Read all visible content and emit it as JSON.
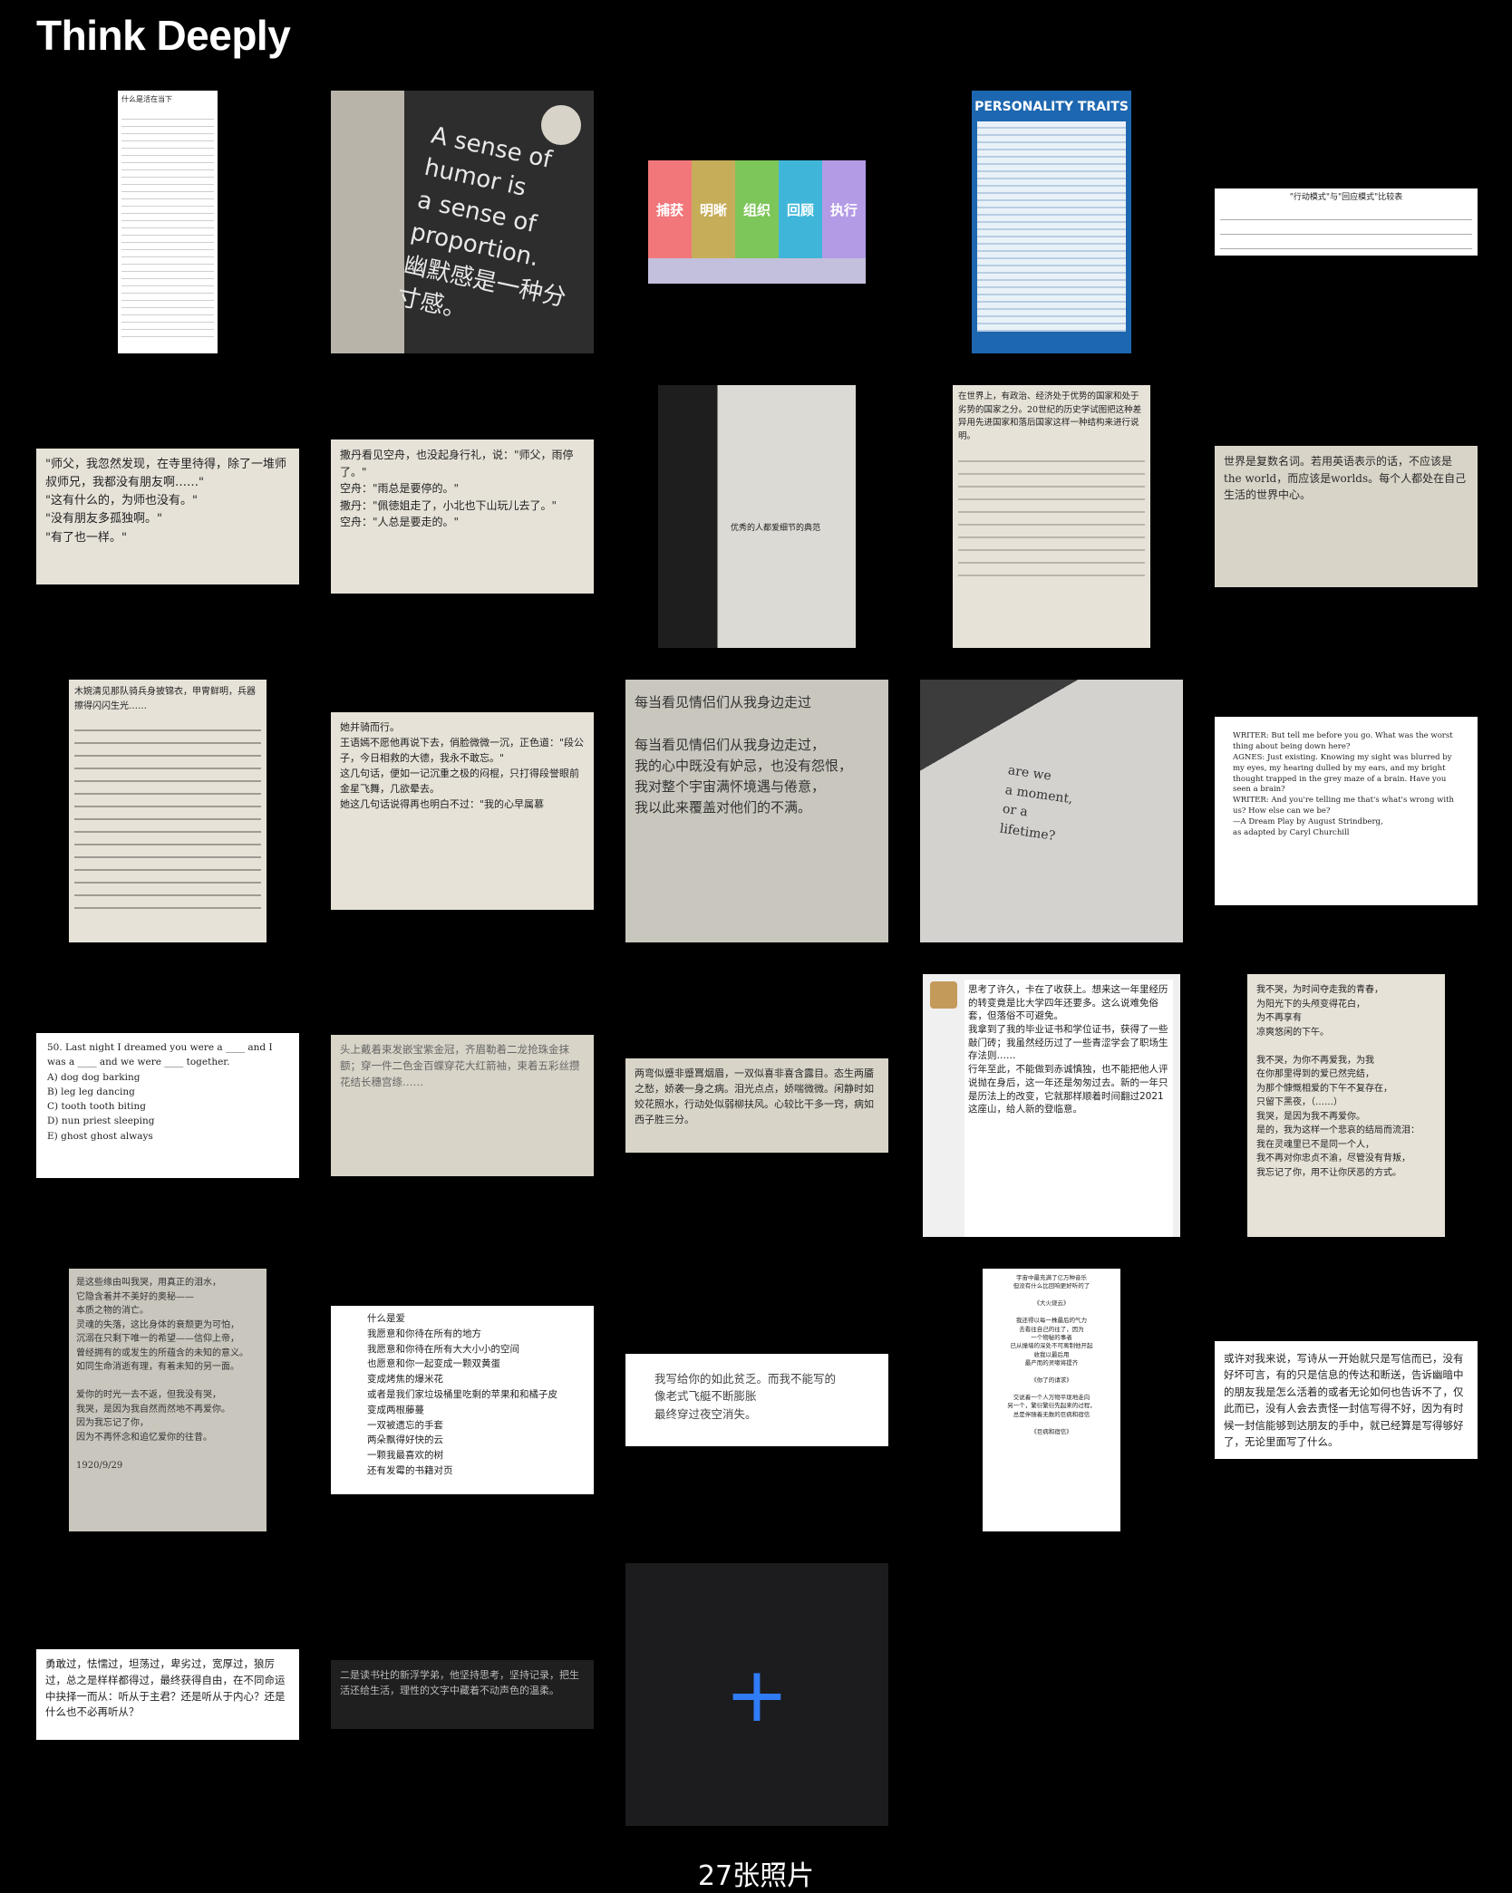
{
  "header": {
    "title": "Think Deeply"
  },
  "footer": {
    "photo_count": "27张照片"
  },
  "add_button": {
    "icon": "plus-icon",
    "label": "+",
    "color": "#2f7cf6"
  },
  "photos": [
    {
      "text": "什么是活在当下",
      "kind": "article"
    },
    {
      "text": "A sense of humor is\na sense of\nproportion.\n幽默感是一种分寸感。",
      "kind": "sign"
    },
    {
      "text": "捕获 明晰 组织 回顾 执行",
      "kind": "color-strip",
      "segments": [
        "捕获",
        "明晰",
        "组织",
        "回顾",
        "执行"
      ],
      "colors": [
        "#f2777a",
        "#c6ad5a",
        "#7dc65a",
        "#3fb6d9",
        "#b39be6"
      ]
    },
    {
      "text": "PERSONALITY TRAITS",
      "kind": "poster"
    },
    {
      "text": "\"行动模式\"与\"回应模式\"比较表",
      "kind": "table"
    },
    {
      "text": "\"师父，我忽然发现，在寺里待得，除了一堆师叔师兄，我都没有朋友啊……\"\n\"这有什么的，为师也没有。\"\n\"没有朋友多孤独啊。\"\n\"有了也一样。\"",
      "kind": "book"
    },
    {
      "text": "撒丹看见空舟，也没起身行礼，说：\"师父，雨停了。\"\n空舟：\"雨总是要停的。\"\n撒丹：\"佩徳姐走了，小北也下山玩儿去了。\"\n空舟：\"人总是要走的。\"",
      "kind": "book"
    },
    {
      "text": "优秀的人都爱细节的典范",
      "kind": "book-photo"
    },
    {
      "text": "在世界上，有政治、经济处于优势的国家和处于劣势的国家之分。20世纪的历史学试图把这种差异用先进国家和落后国家这样一种结构来进行说明。",
      "kind": "book"
    },
    {
      "text": "世界是复数名词。若用英语表示的话，不应该是the world，而应该是worlds。每个人都处在自己生活的世界中心。",
      "kind": "book"
    },
    {
      "text": "木婉清见那队骑兵身披锦衣，甲冑鲜明，兵器擦得闪闪生光……",
      "kind": "book"
    },
    {
      "text": "她并骑而行。\n王语嫣不愿他再说下去，俏脸微微一沉，正色道：\"段公子，今日相救的大德，我永不敢忘。\"\n这几句话，便如一记沉重之极的闷棍，只打得段誉眼前金星飞舞，几欲晕去。\n她这几句话说得再也明白不过：\"我的心早属慕",
      "kind": "book"
    },
    {
      "text": "每当看见情侣们从我身边走过\n\n每当看见情侣们从我身边走过，\n我的心中既没有妒忌，也没有怨恨，\n我对整个宇宙满怀境遇与倦意，\n我以此来覆盖对他们的不满。",
      "kind": "book"
    },
    {
      "text": "are we\na moment,\nor a\nlifetime?",
      "kind": "book-photo"
    },
    {
      "text": "WRITER: But tell me before you go. What was the worst thing about being down here?\nAGNES: Just existing. Knowing my sight was blurred by my eyes, my hearing dulled by my ears, and my bright thought trapped in the grey maze of a brain. Have you seen a brain?\nWRITER: And you're telling me that's what's wrong with us? How else can we be?\n—A Dream Play by August Strindberg,\nas adapted by Caryl Churchill",
      "kind": "script"
    },
    {
      "text": "50. Last night I dreamed you were a ____ and I was a ____ and we were ____ together.\nA) dog dog barking\nB) leg leg dancing\nC) tooth tooth biting\nD) nun priest sleeping\nE) ghost ghost always",
      "kind": "quiz"
    },
    {
      "text": "头上戴着束发嵌宝紫金冠，齐眉勒着二龙抢珠金抹额；穿一件二色金百蝶穿花大红箭袖，束着五彩丝攒花结长穗宫绦……",
      "kind": "book"
    },
    {
      "text": "两弯似蹙非蹙罥烟眉，一双似喜非喜含露目。态生两靥之愁，娇袭一身之病。泪光点点，娇喘微微。闲静时如姣花照水，行动处似弱柳扶风。心较比干多一窍，病如西子胜三分。",
      "kind": "book"
    },
    {
      "text": "思考了许久，卡在了收获上。想来这一年里经历的转变竟是比大学四年还要多。这么说难免俗套，但落俗不可避免。\n我拿到了我的毕业证书和学位证书，获得了一些敲门砖；我虽然经历过了一些青涩学会了职场生存法则……\n行年至此，不能做到赤诚慎独，也不能把他人评说抛在身后，这一年还是匆匆过去。新的一年只是历法上的改变，它就那样顺着时间翻过2021这座山，给人新的登临意。",
      "kind": "chat"
    },
    {
      "text": "我不哭，为时间夺走我的青春，\n为阳光下的头颅变得花白，\n为不再享有\n凉爽悠闲的下午。\n\n我不哭，为你不再爱我，为我\n在你那里得到的爱已然完结，\n为那个慷慨相爱的下午不复存在，\n只留下黑夜，（……）\n我哭，是因为我不再爱你。\n是的，我为这样一个悲哀的结局而流泪：\n我在灵魂里已不是同一个人，\n我不再对你忠贞不渝，尽管没有背叛，\n我忘记了你，用不让你厌恶的方式。",
      "kind": "book"
    },
    {
      "text": "是这些缘由叫我哭，用真正的泪水，\n它隐含着并不美好的奥秘——\n本质之物的消亡。\n灵魂的失落，这比身体的衰颓更为可怕，\n沉溺在只剩下唯一的希望——信仰上帝，\n曾经拥有的或发生的所蕴含的未知的意义。\n如同生命消逝有理，有着未知的另一面。\n\n爱你的时光一去不返，但我没有哭，\n我哭，是因为我自然而然地不再爱你。\n因为我忘记了你，\n因为不再怀念和追忆爱你的往昔。\n\n1920/9/29",
      "kind": "book"
    },
    {
      "text": "什么是爱\n我愿意和你待在所有的地方\n我愿意和你待在所有大大小小的空间\n也愿意和你一起变成一颗双黄蛋\n变成烤焦的爆米花\n或者是我们家垃圾桶里吃剩的苹果和和橘子皮\n变成两根藤蔓\n一双被遗忘的手套\n两朵飘得好快的云\n一颗我最喜欢的树\n还有发霉的书籍对页",
      "kind": "note"
    },
    {
      "text": "我写给你的如此贫乏。而我不能写的\n像老式飞艇不断膨胀\n最终穿过夜空消失。",
      "kind": "note"
    },
    {
      "text": "宇宙中最充满了亿万种音乐\n但没有什么比回响更好听的了\n\n《大火烧云》\n\n我还得以每一株最后的气力\n去看往自己的往了，因为\n一个物秘的事者\n已从撞墙的深处不可离制他开起\n收我以最后用\n最产而的灵嗽将提齐\n\n《你了的请求》\n\n交说着一个人万物平现地走向\n另一个，繁衍繁衍先起来的过程，\n总是伴随着无数的巨病和宿信\n\n《巨病和宿信》",
      "kind": "note"
    },
    {
      "text": "或许对我来说，写诗从一开始就只是写信而已，没有好坏可言，有的只是信息的传达和断送，告诉幽暗中的朋友我是怎么活着的或者无论如何也告诉不了，仅此而已，没有人会去责怪一封信写得不好，因为有时候一封信能够到达朋友的手中，就已经算是写得够好了，无论里面写了什么。",
      "kind": "note"
    },
    {
      "text": "勇敢过，怯懦过，坦荡过，卑劣过，宽厚过，狼厉过，总之是样样都得过，最终获得自由，在不同命运中抉择一而从：听从于主君？还是听从于内心？还是什么也不必再听从？",
      "kind": "note"
    },
    {
      "text": "二是读书社的新浮学弟，他坚持思考，坚持记录，把生活还给生活，理性的文字中藏着不动声色的温柔。",
      "kind": "note"
    }
  ]
}
